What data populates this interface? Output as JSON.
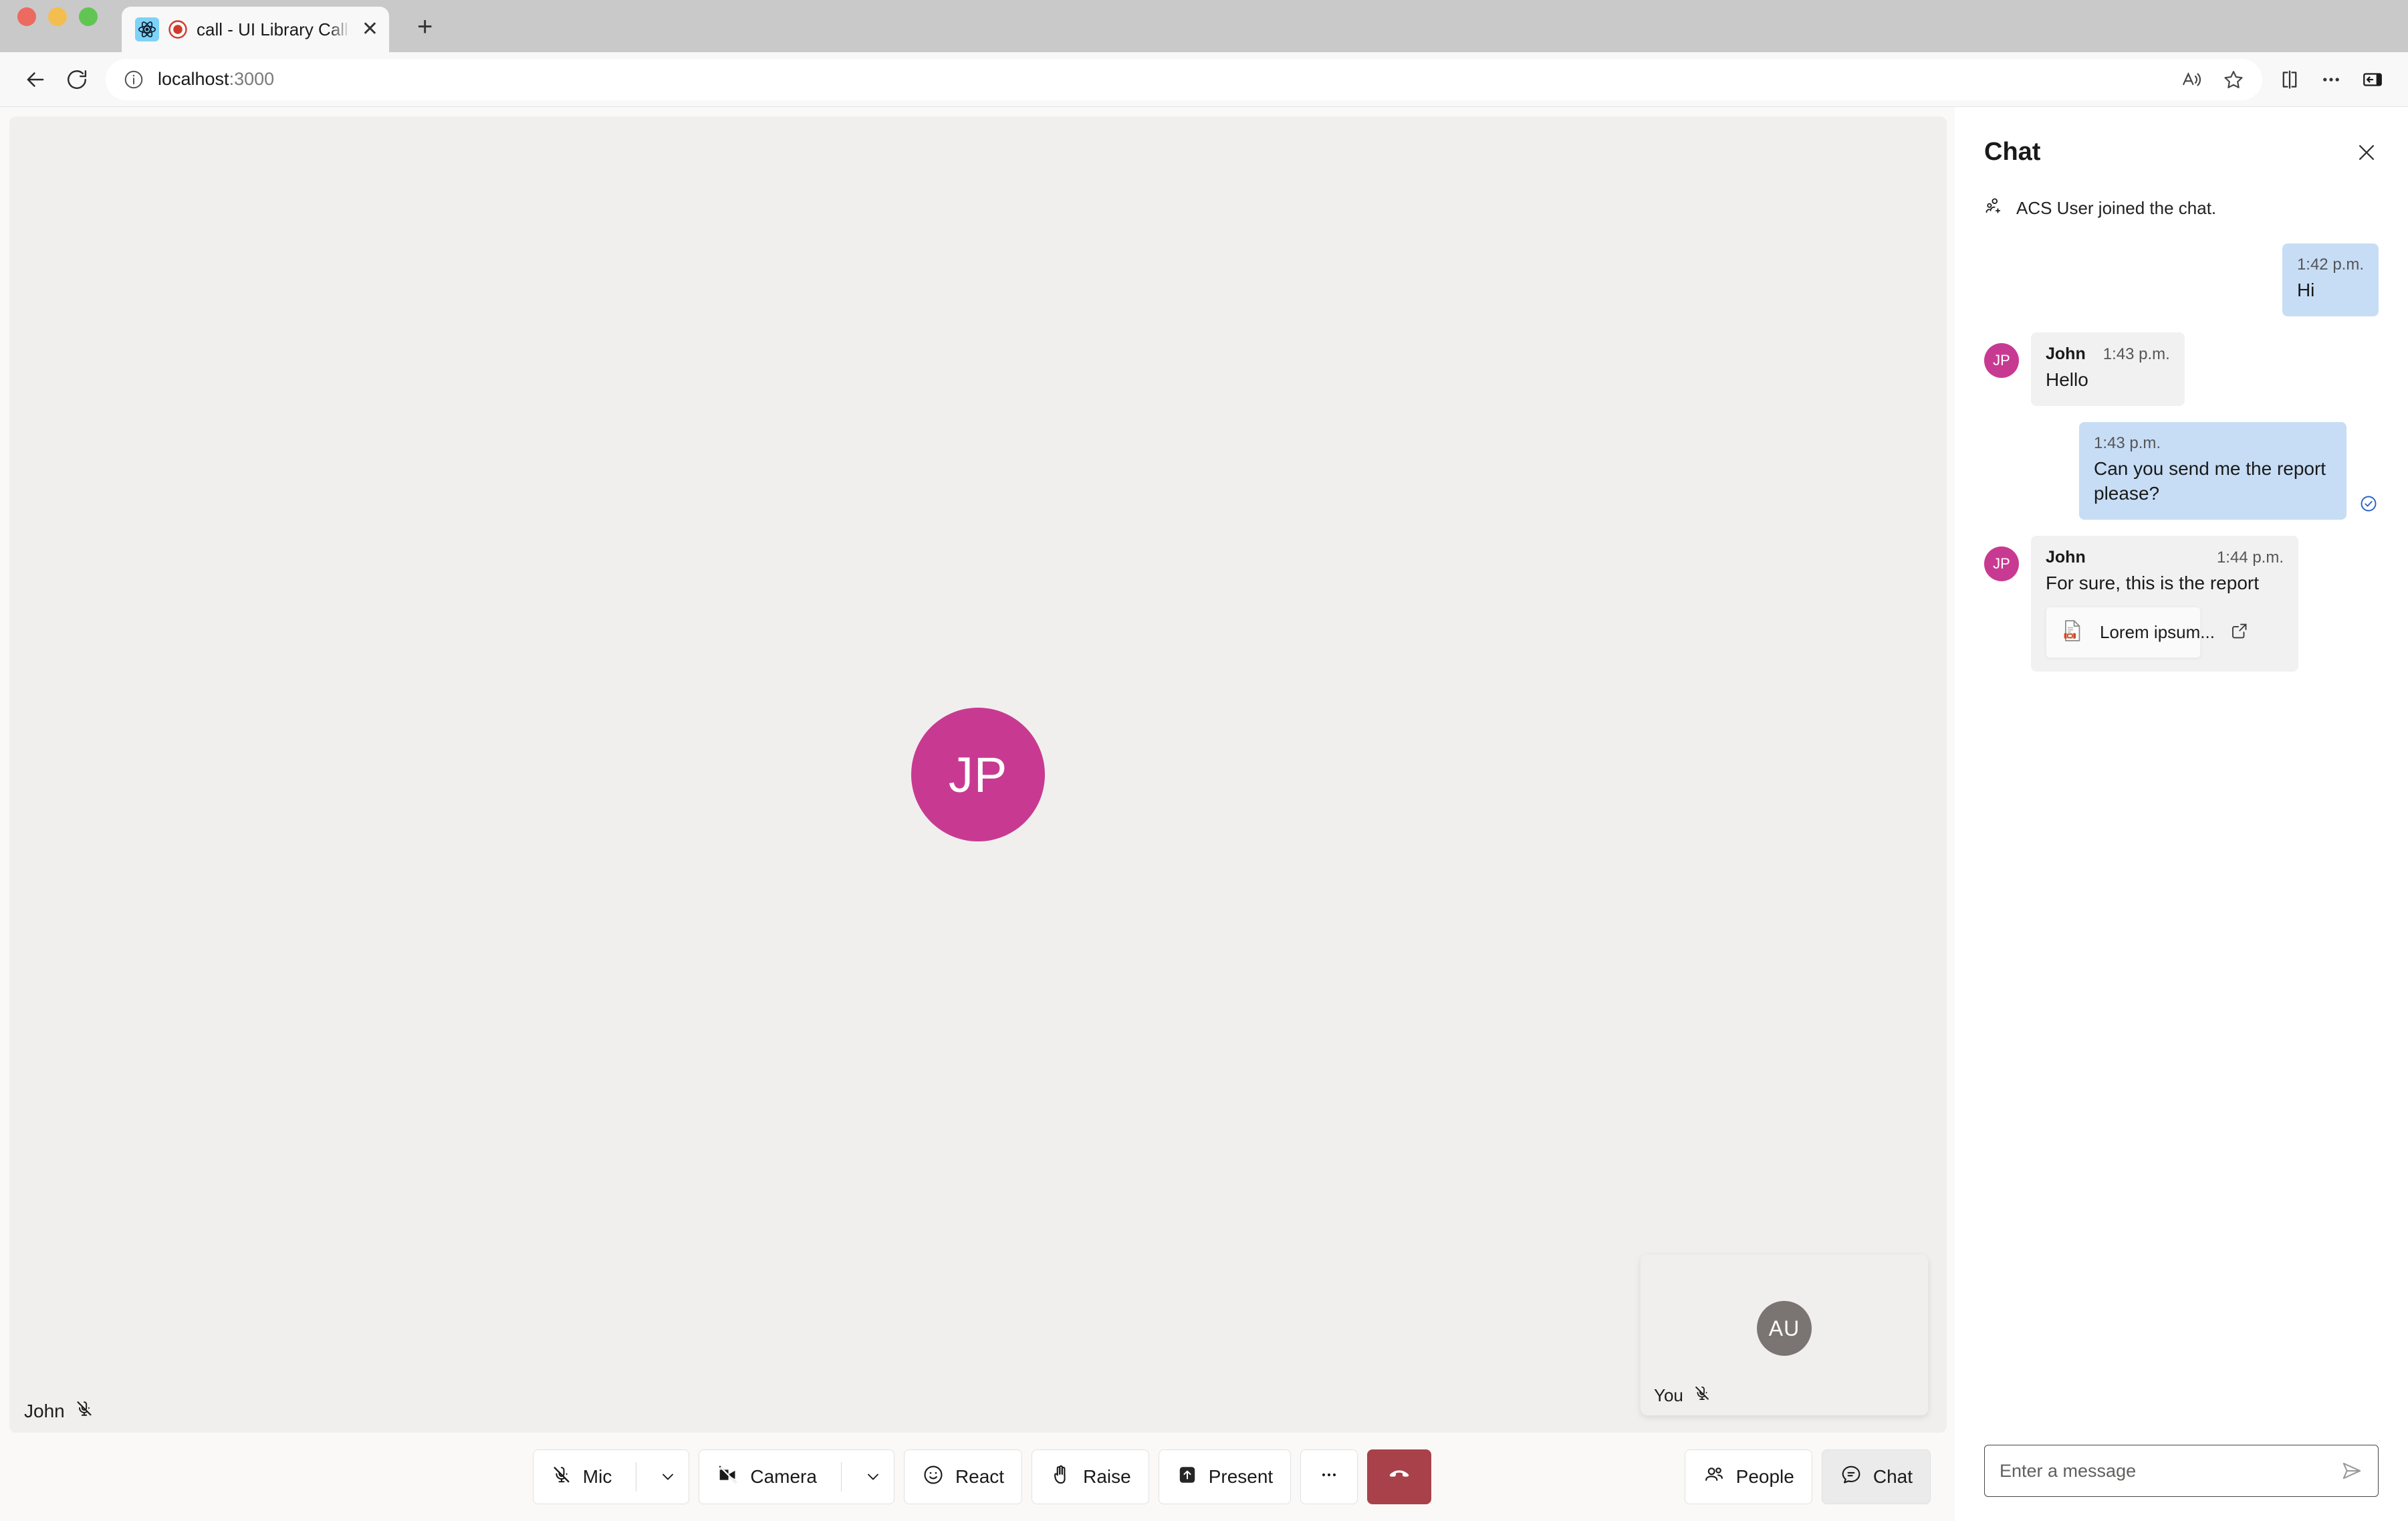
{
  "browser": {
    "tab": {
      "title": "call - UI Library Call With Chat",
      "favicon_name": "react-icon",
      "recording_name": "recording-indicator-icon",
      "close_label": "✕"
    },
    "new_tab_label": "+",
    "address": {
      "host": "localhost",
      "port": ":3000",
      "info_icon": "info-icon"
    },
    "toolbar_icons": [
      "back-icon",
      "reload-icon",
      "read-aloud-icon",
      "favorite-star-icon",
      "split-screen-icon",
      "settings-more-icon",
      "sidebar-icon"
    ]
  },
  "call": {
    "remote_participant": {
      "initials": "JP",
      "name": "John",
      "muted": true,
      "avatar_color": "#C83A91"
    },
    "local_participant": {
      "initials": "AU",
      "name": "You",
      "muted": true,
      "avatar_color": "#7A7572"
    },
    "controls": [
      {
        "id": "mic",
        "label": "Mic",
        "icon": "microphone-off-icon",
        "has_caret": true
      },
      {
        "id": "camera",
        "label": "Camera",
        "icon": "camera-off-icon",
        "has_caret": true
      },
      {
        "id": "react",
        "label": "React",
        "icon": "emoji-smile-icon",
        "has_caret": false
      },
      {
        "id": "raise",
        "label": "Raise",
        "icon": "raised-hand-icon",
        "has_caret": false
      },
      {
        "id": "present",
        "label": "Present",
        "icon": "share-screen-icon",
        "has_caret": false
      },
      {
        "id": "more",
        "label": "",
        "icon": "more-horizontal-icon",
        "has_caret": false
      },
      {
        "id": "hangup",
        "label": "",
        "icon": "end-call-icon",
        "has_caret": false
      }
    ],
    "right_controls": [
      {
        "id": "people",
        "label": "People",
        "icon": "people-icon",
        "active": false
      },
      {
        "id": "chat",
        "label": "Chat",
        "icon": "chat-bubble-icon",
        "active": true
      }
    ]
  },
  "chat": {
    "title": "Chat",
    "close_icon": "close-icon",
    "system_message": {
      "icon": "person-add-icon",
      "text": "ACS User joined the chat."
    },
    "messages": [
      {
        "side": "me",
        "time": "1:42 p.m.",
        "text": "Hi",
        "sender": "",
        "read": false
      },
      {
        "side": "them",
        "sender": "John",
        "initials": "JP",
        "time": "1:43 p.m.",
        "text": "Hello"
      },
      {
        "side": "me",
        "time": "1:43 p.m.",
        "text": "Can you send me the report please?",
        "read": true,
        "read_icon": "message-read-icon"
      },
      {
        "side": "them",
        "sender": "John",
        "initials": "JP",
        "time": "1:44 p.m.",
        "text": "For sure, this is the report",
        "attachment": {
          "name": "Lorem ipsum...",
          "file_icon": "powerpoint-file-icon",
          "open_icon": "open-external-icon"
        }
      }
    ],
    "input": {
      "placeholder": "Enter a message",
      "value": "",
      "send_icon": "send-icon"
    }
  },
  "colors": {
    "accent_magenta": "#C83A91",
    "bubble_me": "#C7DDF5",
    "bubble_them": "#F1F1F1",
    "hangup_red": "#A9414B",
    "read_blue": "#2C64C5",
    "stage_bg": "#F0EFEE"
  }
}
